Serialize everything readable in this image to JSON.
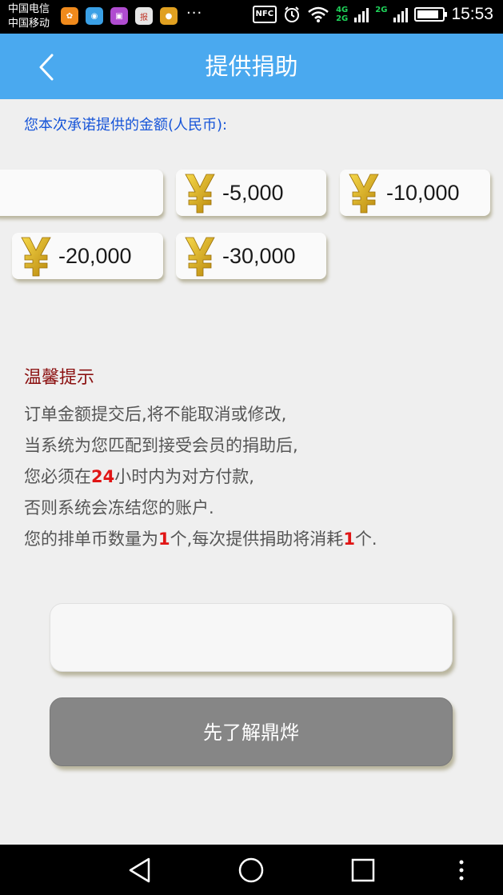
{
  "status_bar": {
    "carrier1": "中国电信",
    "carrier2": "中国移动",
    "app_icons": [
      {
        "name": "app-orange-icon",
        "label": "✿",
        "color": "#f08a1c"
      },
      {
        "name": "app-browser-icon",
        "label": "◉",
        "color": "#3aa0e6"
      },
      {
        "name": "app-gallery-icon",
        "label": "▣",
        "color": "#b04cd0"
      },
      {
        "name": "app-news-icon",
        "label": "报",
        "color": "#e6e6e6"
      },
      {
        "name": "app-yellow-icon",
        "label": "●",
        "color": "#e0a020"
      }
    ],
    "more": "···",
    "nfc": "NFC",
    "net1": "4G",
    "net2": "2G",
    "net3": "2G",
    "battery_level": 0.85,
    "time": "15:53"
  },
  "header": {
    "title": "提供捐助"
  },
  "prompt": "您本次承诺提供的金额(人民币):",
  "amounts": {
    "a1": "",
    "a2": "-5,000",
    "a3": "-10,000",
    "a4": "-20,000",
    "a5": "-30,000"
  },
  "tips": {
    "title": "温馨提示",
    "line1": "订单金额提交后,将不能取消或修改,",
    "line2": "当系统为您匹配到接受会员的捐助后,",
    "line3_pre": "您必须在",
    "line3_num": "24",
    "line3_post": "小时内为对方付款,",
    "line4": "否则系统会冻结您的账户.",
    "line5_pre": "您的排单币数量为",
    "line5_num1": "1",
    "line5_mid": "个,每次提供捐助将消耗",
    "line5_num2": "1",
    "line5_post": "个."
  },
  "input": {
    "value": ""
  },
  "learn_button": "先了解鼎烨",
  "colors": {
    "header": "#4aa9ef",
    "prompt": "#1654d8",
    "tips_title": "#8b1010",
    "highlight": "#e01515",
    "button_gray": "#868686"
  }
}
